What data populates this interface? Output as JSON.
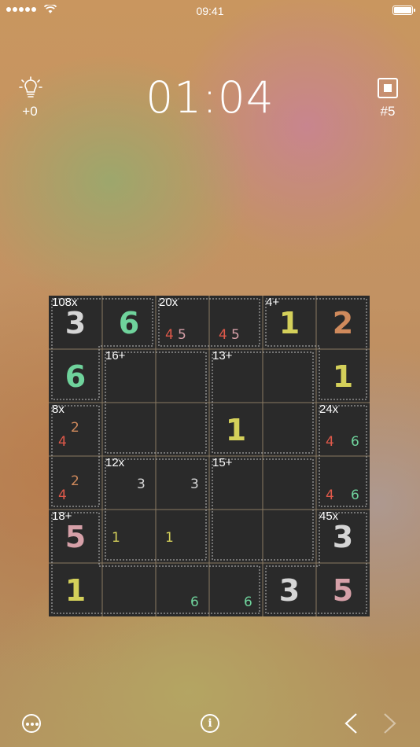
{
  "status_bar": {
    "time": "09:41"
  },
  "header": {
    "hint_count": "+0",
    "timer": "01:04",
    "level": "#5"
  },
  "colors": {
    "c3": "#d5d5d5",
    "c6": "#6fd39c",
    "c2": "#d08a5c",
    "c1": "#d4d05a",
    "c5": "#d6a0a8",
    "c4": "#e0594a"
  },
  "cage_labels": {
    "r0c0": "108x",
    "r0c2": "20x",
    "r0c4": "4+",
    "r1c1": "16+",
    "r1c3": "13+",
    "r2c0": "8x",
    "r2c5": "24x",
    "r3c1": "12x",
    "r3c3": "15+",
    "r4c0": "18+",
    "r4c5": "45x"
  },
  "values": {
    "r0c0": "3",
    "r0c1": "6",
    "r0c4": "1",
    "r0c5": "2",
    "r1c0": "6",
    "r1c5": "1",
    "r2c3": "1",
    "r4c0": "5",
    "r4c5": "3",
    "r5c0": "1",
    "r5c4": "3",
    "r5c5": "5"
  },
  "notes": {
    "r0c2": [
      "4",
      "5"
    ],
    "r0c3": [
      "4",
      "5"
    ],
    "r2c0": [
      "2",
      "4"
    ],
    "r2c5": [
      "4",
      "6"
    ],
    "r3c0": [
      "2",
      "4"
    ],
    "r3c1": [
      "3"
    ],
    "r3c2": [
      "3"
    ],
    "r3c5": [
      "4",
      "6"
    ],
    "r4c1": [
      "1"
    ],
    "r4c2": [
      "1"
    ],
    "r5c2": [
      "6"
    ],
    "r5c3": [
      "6"
    ]
  }
}
